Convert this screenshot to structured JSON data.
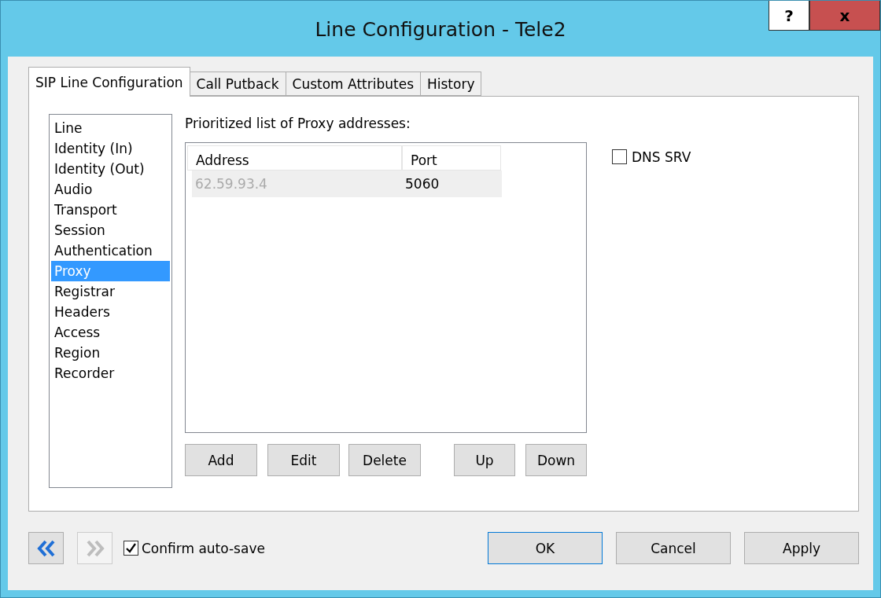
{
  "window": {
    "title": "Line Configuration - Tele2",
    "help_button": "?",
    "close_button": "x"
  },
  "tabs": [
    {
      "label": "SIP Line Configuration",
      "selected": true
    },
    {
      "label": "Call Putback",
      "selected": false
    },
    {
      "label": "Custom Attributes",
      "selected": false
    },
    {
      "label": "History",
      "selected": false
    }
  ],
  "sections": [
    {
      "label": "Line",
      "selected": false
    },
    {
      "label": "Identity (In)",
      "selected": false
    },
    {
      "label": "Identity (Out)",
      "selected": false
    },
    {
      "label": "Audio",
      "selected": false
    },
    {
      "label": "Transport",
      "selected": false
    },
    {
      "label": "Session",
      "selected": false
    },
    {
      "label": "Authentication",
      "selected": false
    },
    {
      "label": "Proxy",
      "selected": true
    },
    {
      "label": "Registrar",
      "selected": false
    },
    {
      "label": "Headers",
      "selected": false
    },
    {
      "label": "Access",
      "selected": false
    },
    {
      "label": "Region",
      "selected": false
    },
    {
      "label": "Recorder",
      "selected": false
    }
  ],
  "proxy": {
    "label": "Prioritized list of Proxy addresses:",
    "columns": [
      "Address",
      "Port"
    ],
    "rows": [
      {
        "cells": [
          "62.59.93.4",
          "5060"
        ],
        "selected": true
      }
    ],
    "buttons": [
      "Add",
      "Edit",
      "Delete",
      "Up",
      "Down"
    ],
    "dns_srv": {
      "label": "DNS SRV",
      "checked": false
    }
  },
  "footer": {
    "back": {
      "disabled": false
    },
    "forward": {
      "disabled": true
    },
    "confirm": {
      "label": "Confirm auto-save",
      "checked": true
    },
    "buttons": [
      {
        "label": "OK",
        "default": true
      },
      {
        "label": "Cancel",
        "default": false
      },
      {
        "label": "Apply",
        "default": false
      }
    ]
  }
}
